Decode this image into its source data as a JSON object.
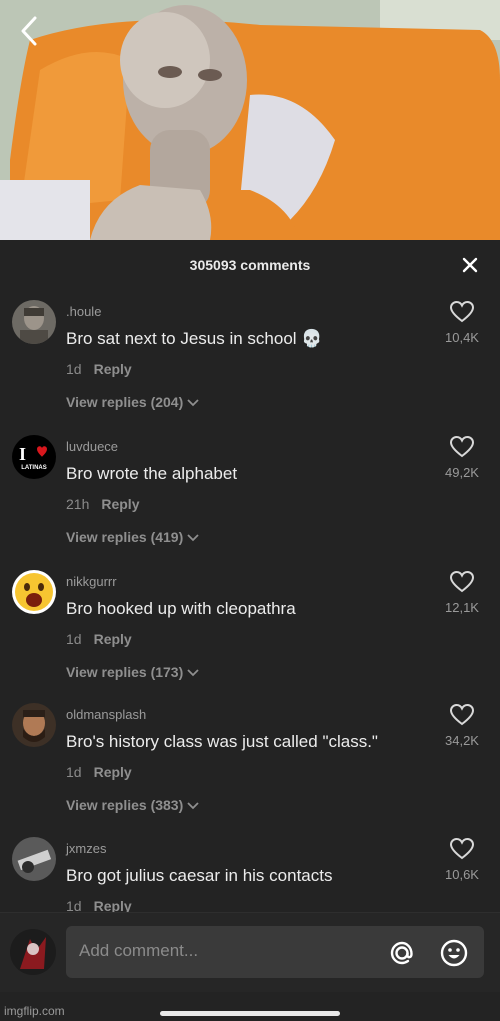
{
  "video": {
    "description": ""
  },
  "header": {
    "title": "305093 comments"
  },
  "comments": [
    {
      "user": ".houle",
      "text": "Bro sat next to Jesus in school 💀",
      "time": "1d",
      "reply": "Reply",
      "view_replies": "View replies (204)",
      "likes": "10,4K"
    },
    {
      "user": "luvduece",
      "text": "Bro wrote the alphabet",
      "time": "21h",
      "reply": "Reply",
      "view_replies": "View replies (419)",
      "likes": "49,2K",
      "avatar_text": "LATINAS"
    },
    {
      "user": "nikkgurrr",
      "text": "Bro hooked up with cleopathra",
      "time": "1d",
      "reply": "Reply",
      "view_replies": "View replies (173)",
      "likes": "12,1K"
    },
    {
      "user": "oldmansplash",
      "text": "Bro's history class was just called \"class.\"",
      "time": "1d",
      "reply": "Reply",
      "view_replies": "View replies (383)",
      "likes": "34,2K"
    },
    {
      "user": "jxmzes",
      "text": "Bro got julius caesar in his contacts",
      "time": "1d",
      "reply": "Reply",
      "likes": "10,6K"
    }
  ],
  "input": {
    "placeholder": "Add comment..."
  },
  "watermark": "imgflip.com",
  "colors": {
    "background": "#232323",
    "video_sofa": "#e98a2a",
    "pillow": "#d9d9de"
  }
}
